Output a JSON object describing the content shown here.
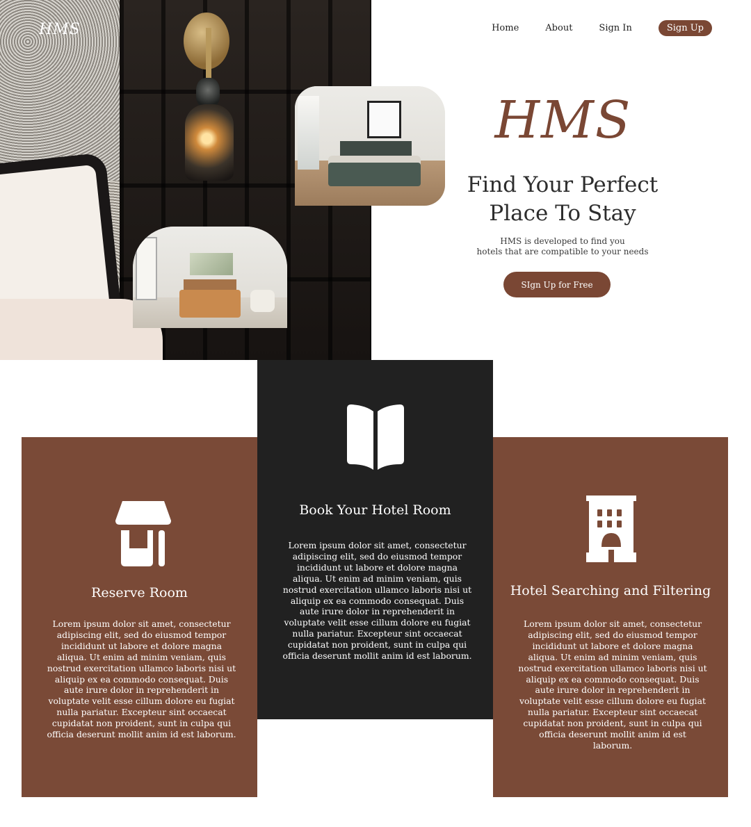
{
  "brand": {
    "logo": "HMS",
    "big_title": "HMS"
  },
  "nav": {
    "items": [
      {
        "label": "Home"
      },
      {
        "label": "About"
      },
      {
        "label": "Sign In"
      }
    ],
    "signup_label": "Sign Up"
  },
  "hero": {
    "headline": "Find Your Perfect Place To Stay",
    "tagline_line1": "HMS is developed to find you",
    "tagline_line2": "hotels that are compatible to your needs",
    "cta_label": "SIgn Up for Free"
  },
  "colors": {
    "accent": "#7a4734",
    "card_brown": "#7a4a37",
    "card_dark": "#212121"
  },
  "features": [
    {
      "icon": "storefront-icon",
      "title": "Reserve Room",
      "text": "Lorem ipsum dolor sit amet, consectetur adipiscing elit, sed do eiusmod tempor incididunt ut labore et dolore magna aliqua. Ut enim ad minim veniam, quis nostrud exercitation ullamco laboris nisi ut aliquip ex ea commodo consequat. Duis aute irure dolor in reprehenderit in voluptate velit esse cillum dolore eu fugiat nulla pariatur. Excepteur sint occaecat cupidatat non proident, sunt in culpa qui officia deserunt mollit anim id est laborum."
    },
    {
      "icon": "open-book-icon",
      "title": "Book Your Hotel Room",
      "text": "Lorem ipsum dolor sit amet, consectetur adipiscing elit, sed do eiusmod tempor incididunt ut labore et dolore magna aliqua. Ut enim ad minim veniam, quis nostrud exercitation ullamco laboris nisi ut aliquip ex ea commodo consequat. Duis aute irure dolor in reprehenderit in voluptate velit esse cillum dolore eu fugiat nulla pariatur. Excepteur sint occaecat cupidatat non proident, sunt in culpa qui officia deserunt mollit anim id est laborum."
    },
    {
      "icon": "hotel-building-icon",
      "title": "Hotel Searching and Filtering",
      "text": "Lorem ipsum dolor sit amet, consectetur adipiscing elit, sed do eiusmod tempor incididunt ut labore et dolore magna aliqua. Ut enim ad minim veniam, quis nostrud exercitation ullamco laboris nisi ut aliquip ex ea commodo consequat. Duis aute irure dolor in reprehenderit in voluptate velit esse cillum dolore eu fugiat nulla pariatur. Excepteur sint occaecat cupidatat non proident, sunt in culpa qui officia deserunt mollit anim id est laborum."
    }
  ]
}
